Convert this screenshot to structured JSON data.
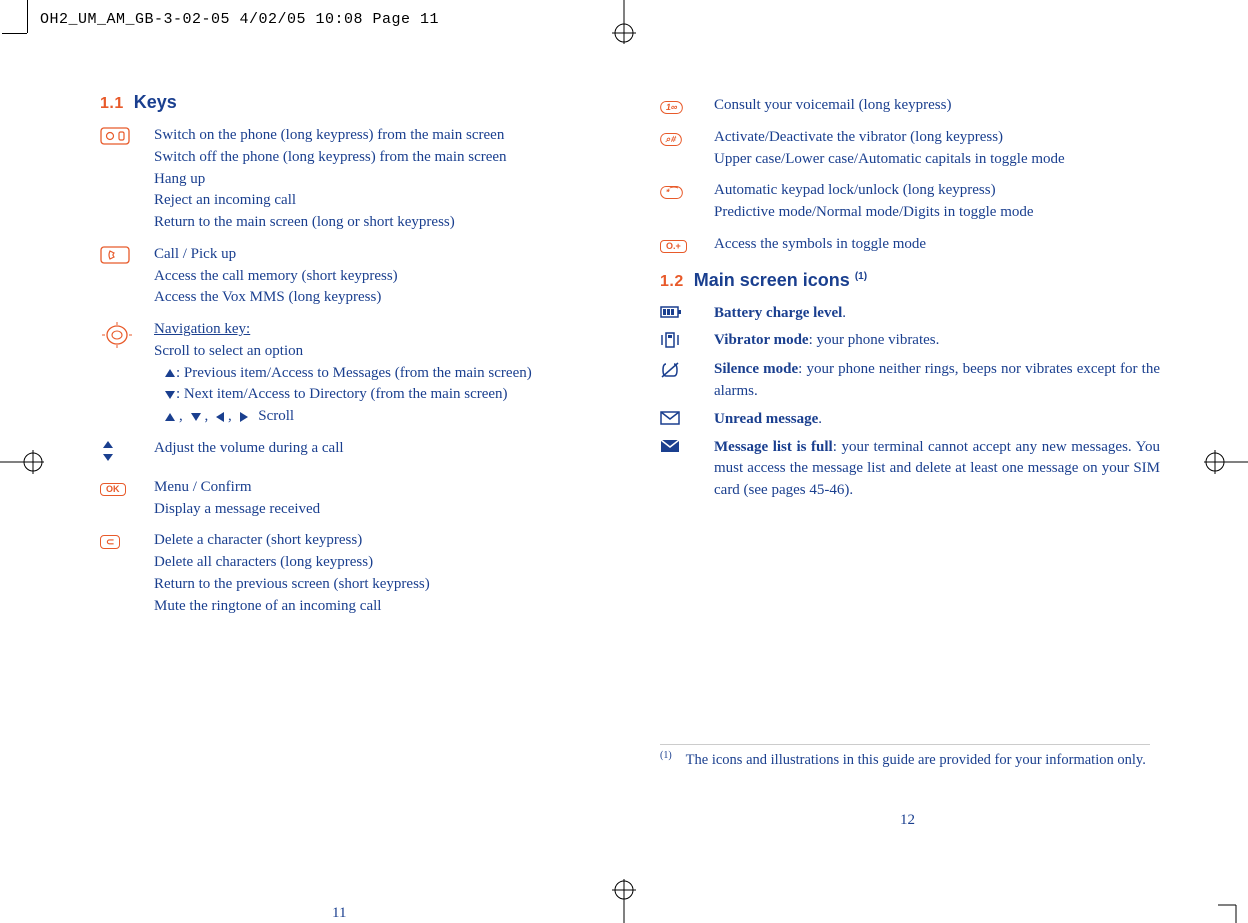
{
  "print_header": "OH2_UM_AM_GB-3-02-05   4/02/05  10:08  Page 11",
  "left": {
    "section_num": "1.1",
    "section_title": "Keys",
    "items": [
      {
        "icon": "power-key",
        "lines": [
          "Switch on the phone (long keypress) from the main screen",
          "Switch off the phone (long keypress) from the main screen",
          "Hang up",
          "Reject an incoming call",
          "Return to the main screen (long or short keypress)"
        ]
      },
      {
        "icon": "call-key",
        "lines": [
          "Call / Pick up",
          "Access the call memory (short keypress)",
          "Access the Vox MMS (long keypress)"
        ]
      },
      {
        "icon": "nav-key",
        "nav": {
          "title": "Navigation key:",
          "subtitle": "Scroll to select an option",
          "up": ": Previous item/Access to Messages (from the main screen)",
          "down": ": Next item/Access to Directory (from the main screen)",
          "scroll": "Scroll"
        }
      },
      {
        "icon": "volume-key",
        "lines": [
          "Adjust the volume during a call"
        ]
      },
      {
        "icon": "ok-key",
        "lines": [
          "Menu / Confirm",
          "Display a message received"
        ]
      },
      {
        "icon": "c-key",
        "lines": [
          "Delete a character (short keypress)",
          "Delete all characters (long keypress)",
          "Return to the previous screen (short keypress)",
          "Mute the ringtone of an incoming call"
        ]
      }
    ],
    "page_num": "11"
  },
  "right": {
    "top_items": [
      {
        "icon": "key-1",
        "label": "1∞",
        "lines": [
          "Consult your voicemail (long keypress)"
        ]
      },
      {
        "icon": "key-hash",
        "label": "⌕#",
        "lines": [
          "Activate/Deactivate the vibrator (long keypress)",
          "Upper case/Lower case/Automatic capitals in toggle mode"
        ]
      },
      {
        "icon": "key-star",
        "label": "*⁀",
        "lines": [
          "Automatic keypad lock/unlock (long keypress)",
          "Predictive mode/Normal mode/Digits in toggle mode"
        ]
      },
      {
        "icon": "key-0",
        "label": "O.+",
        "lines": [
          "Access the symbols in toggle mode"
        ]
      }
    ],
    "section_num": "1.2",
    "section_title": "Main screen icons ",
    "section_sup": "(1)",
    "icon_items": [
      {
        "icon": "battery-icon",
        "bold": "Battery charge level",
        "rest": "."
      },
      {
        "icon": "vibrator-icon",
        "bold": "Vibrator mode",
        "rest": ": your phone vibrates."
      },
      {
        "icon": "silence-icon",
        "bold": "Silence mode",
        "rest": ": your phone neither rings, beeps nor vibrates except for the alarms.",
        "justify": true
      },
      {
        "icon": "unread-icon",
        "bold": "Unread message",
        "rest": "."
      },
      {
        "icon": "msg-full-icon",
        "bold": "Message list is full",
        "rest": ": your terminal cannot accept any new messages. You must access the message list and delete at least one message on your SIM card (see pages 45-46).",
        "justify": true
      }
    ],
    "footnote_mark": "(1)",
    "footnote_text": "The icons and illustrations in this guide are provided for your information only.",
    "page_num": "12"
  }
}
